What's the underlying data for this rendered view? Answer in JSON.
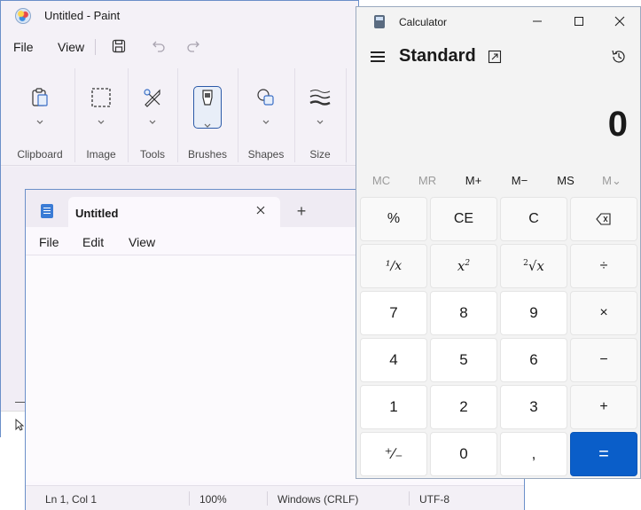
{
  "paint": {
    "title": "Untitled - Paint",
    "menu": {
      "file": "File",
      "view": "View"
    },
    "ribbon": {
      "clipboard": "Clipboard",
      "image": "Image",
      "tools": "Tools",
      "brushes": "Brushes",
      "shapes": "Shapes",
      "size": "Size"
    }
  },
  "notepad": {
    "tab_title": "Untitled",
    "new_tab": "+",
    "menu": {
      "file": "File",
      "edit": "Edit",
      "view": "View"
    },
    "status": {
      "position": "Ln 1, Col 1",
      "zoom": "100%",
      "line_ending": "Windows (CRLF)",
      "encoding": "UTF-8"
    }
  },
  "calculator": {
    "title": "Calculator",
    "mode": "Standard",
    "display": "0",
    "memory": {
      "mc": "MC",
      "mr": "MR",
      "mplus": "M+",
      "mminus": "M−",
      "ms": "MS",
      "mlist": "M⌄"
    },
    "keys": {
      "percent": "%",
      "ce": "CE",
      "c": "C",
      "divide": "÷",
      "multiply": "×",
      "minus": "−",
      "plus": "+",
      "equals": "=",
      "seven": "7",
      "eight": "8",
      "nine": "9",
      "four": "4",
      "five": "5",
      "six": "6",
      "one": "1",
      "two": "2",
      "three": "3",
      "negate": "⁺∕₋",
      "zero": "0",
      "decimal": ","
    }
  }
}
